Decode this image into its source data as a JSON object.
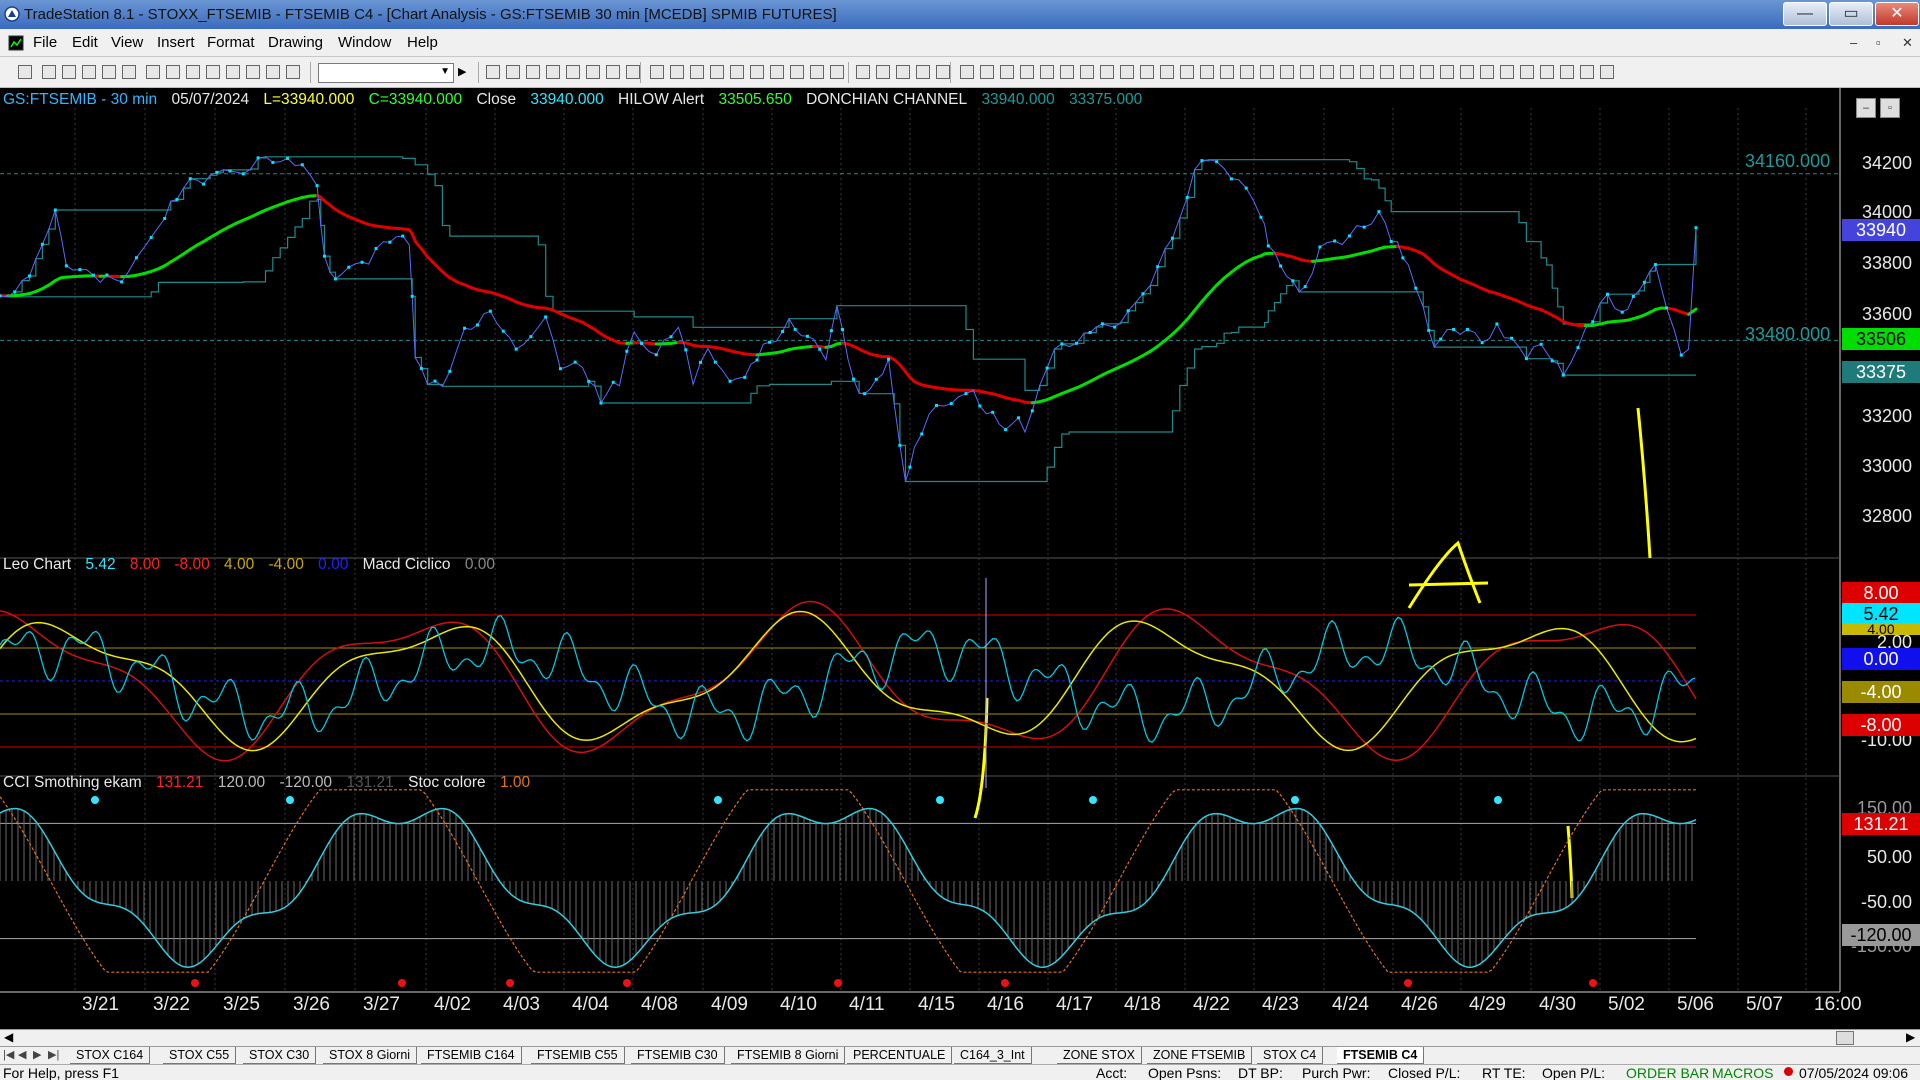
{
  "window": {
    "title": "TradeStation 8.1 - STOXX_FTSEMIB - FTSEMIB C4 - [Chart Analysis - GS:FTSEMIB  30 min  [MCEDB] SPMIB FUTURES]",
    "minimize": "—",
    "restore": "▭",
    "close": "✕",
    "mdi_min": "–",
    "mdi_restore": "▫",
    "mdi_close": "✕"
  },
  "menu": [
    "File",
    "Edit",
    "View",
    "Insert",
    "Format",
    "Drawing",
    "Window",
    "Help"
  ],
  "toolbar": {
    "combo_value": "",
    "combo_arrow": "▼",
    "next_arrow": "▶"
  },
  "price_header": {
    "symbol": "GS:FTSEMIB - 30 min",
    "date": "05/07/2024",
    "low": "L=33940.000",
    "close": "C=33940.000",
    "close_label": "Close",
    "close_value": "33940.000",
    "hilow_label": "HILOW Alert",
    "hilow_value": "33505.650",
    "donchian_label": "DONCHIAN CHANNEL",
    "donchian_upper": "33940.000",
    "donchian_lower": "33375.000"
  },
  "leo_header": {
    "name": "Leo Chart",
    "v1": "5.42",
    "v2": "8.00",
    "v3": "-8.00",
    "v4": "4.00",
    "v5": "-4.00",
    "v6": "0.00",
    "macd_label": "Macd Ciclico",
    "macd_value": "0.00"
  },
  "cci_header": {
    "name": "CCI Smothing ekam",
    "v1": "131.21",
    "v2": "120.00",
    "v3": "-120.00",
    "v4": "131.21",
    "stoc_label": "Stoc colore",
    "stoc_value": "1.00"
  },
  "price_axis": [
    "34200",
    "34000",
    "33800",
    "33600",
    "33200",
    "33000",
    "32800"
  ],
  "price_levels": {
    "upper": "34160.000",
    "lower": "33480.000"
  },
  "price_tags": {
    "last": "33940",
    "hilow": "33506",
    "donchian_low": "33375"
  },
  "leo_axis": [
    "2.00",
    "-10.00"
  ],
  "leo_tags": {
    "p8": "8.00",
    "cur": "5.42",
    "p4": "4.00",
    "zero": "0.00",
    "m4": "-4.00",
    "m8": "-8.00"
  },
  "cci_axis": [
    "150.00",
    "50.00",
    "-50.00",
    "-150.00"
  ],
  "cci_tags": {
    "cur": "131.21",
    "m120": "-120.00"
  },
  "dates": [
    "3/21",
    "3/22",
    "3/25",
    "3/26",
    "3/27",
    "4/02",
    "4/03",
    "4/04",
    "4/08",
    "4/09",
    "4/10",
    "4/11",
    "4/15",
    "4/16",
    "4/17",
    "4/18",
    "4/22",
    "4/23",
    "4/24",
    "4/26",
    "4/29",
    "4/30",
    "5/02",
    "5/06",
    "5/07",
    "16:00"
  ],
  "tabs": [
    "STOX C164",
    "STOX C55",
    "STOX C30",
    "STOX 8 Giorni",
    "FTSEMIB C164",
    "FTSEMIB C55",
    "FTSEMIB C30",
    "FTSEMIB 8 Giorni",
    "PERCENTUALE",
    "C164_3_Int",
    "ZONE STOX",
    "ZONE FTSEMIB",
    "STOX C4",
    "FTSEMIB C4"
  ],
  "tab_nav": [
    "|◀",
    "◀",
    "▶",
    "▶|"
  ],
  "status": {
    "help": "For Help, press F1",
    "acct": "Acct:",
    "open_psns": "Open Psns:",
    "dt_bp": "DT BP:",
    "purch_pwr": "Purch Pwr:",
    "closed_pl": "Closed P/L:",
    "rt_te": "RT TE:",
    "open_pl": "Open P/L:",
    "order_bar": "ORDER BAR",
    "macros": "MACROS",
    "datetime": "07/05/2024 09:06"
  },
  "colors": {
    "price": "#00e5ff",
    "channel": "#1f8a8a",
    "up": "#00e000",
    "down": "#e00000",
    "yellow": "#ffff00",
    "red_line": "#d01010",
    "grid": "#3a3a3a"
  }
}
